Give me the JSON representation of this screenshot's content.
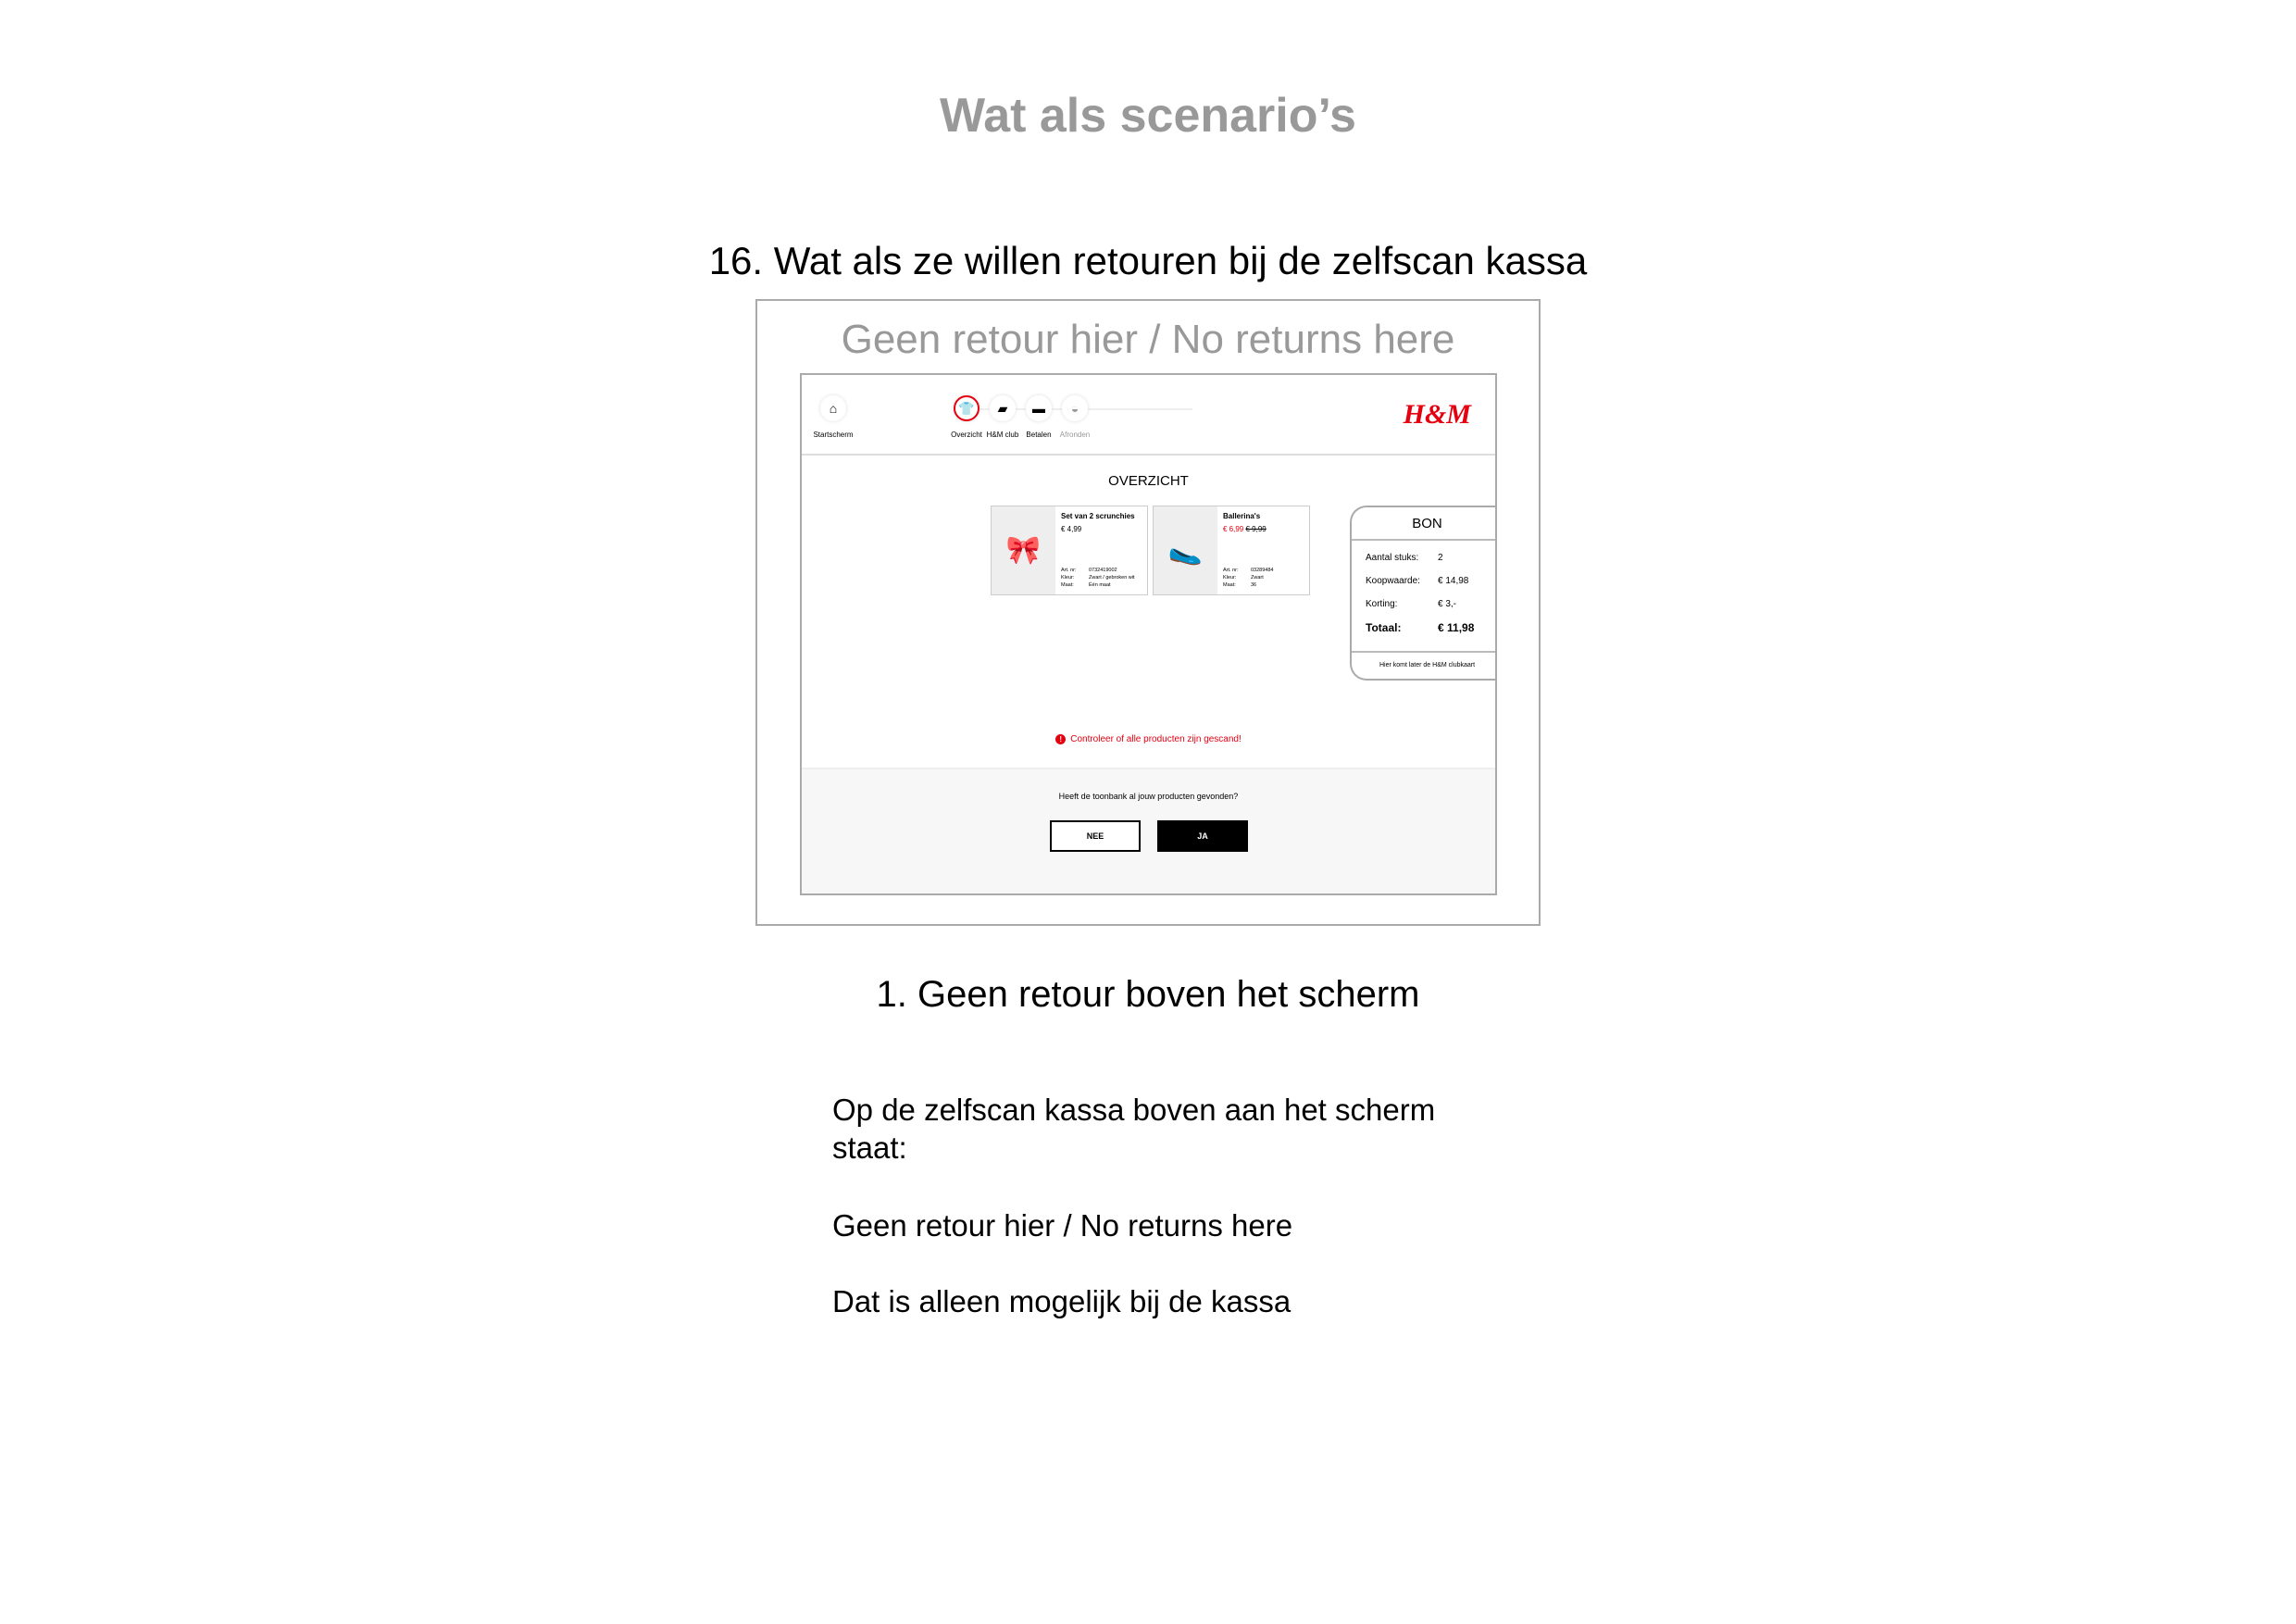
{
  "page_title": "Wat als scenario’s",
  "scenario_heading": "16. Wat als ze willen retouren bij de zelfscan kassa",
  "sign_text": "Geen retour hier / No returns here",
  "kiosk": {
    "steps": [
      {
        "label": "Startscherm",
        "icon": "home-icon"
      },
      {
        "label": "Overzicht",
        "icon": "tshirt-icon",
        "active": true
      },
      {
        "label": "H&M club",
        "icon": "card-icon"
      },
      {
        "label": "Betalen",
        "icon": "payment-icon"
      },
      {
        "label": "Afronden",
        "icon": "bag-icon",
        "disabled": true
      }
    ],
    "logo": "H&M",
    "section_title": "OVERZICHT",
    "products": [
      {
        "name": "Set van 2 scrunchies",
        "price": "€ 4,99",
        "old_price": "",
        "art_label": "Art. nr:",
        "art": "0732419002",
        "color_label": "Kleur:",
        "color": "Zwart / gebroken wit",
        "size_label": "Maat:",
        "size": "Één maat"
      },
      {
        "name": "Ballerina's",
        "price": "€ 6,99",
        "old_price": "€ 9,99",
        "art_label": "Art. nr:",
        "art": "03289484",
        "color_label": "Kleur:",
        "color": "Zwart",
        "size_label": "Maat:",
        "size": "36"
      }
    ],
    "receipt": {
      "title": "BON",
      "rows": [
        {
          "label": "Aantal stuks:",
          "value": "2"
        },
        {
          "label": "Koopwaarde:",
          "value": "€ 14,98"
        },
        {
          "label": "Korting:",
          "value": "€ 3,-"
        },
        {
          "label": "Totaal:",
          "value": "€ 11,98"
        }
      ],
      "footer": "Hier komt later de H&M clubkaart"
    },
    "warning": "Controleer of alle producten zijn gescand!",
    "question": "Heeft de toonbank al jouw producten gevonden?",
    "no_label": "NEE",
    "yes_label": "JA",
    "accent": "#e50010"
  },
  "solution_heading": "1. Geen retour boven het scherm",
  "paragraphs": [
    "Op de zelfscan kassa boven aan het scherm staat:",
    "Geen retour hier / No returns here",
    "Dat is alleen mogelijk bij de kassa"
  ]
}
